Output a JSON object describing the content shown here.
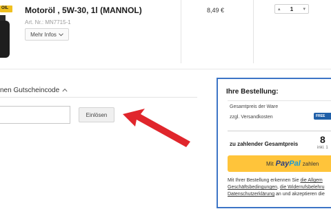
{
  "product": {
    "logo_text": "OIL",
    "title": "Motoröl , 5W-30, 1l (MANNOL)",
    "article_number": "Art. Nr.: MN7715-1",
    "more_info_label": "Mehr Infos",
    "price": "8,49 €",
    "quantity": "1"
  },
  "voucher": {
    "link_text": "nen Gutscheincode",
    "input_value": "",
    "redeem_label": "Einlösen"
  },
  "order": {
    "title": "Ihre Bestellung:",
    "goods_label": "Gesamtpreis der Ware",
    "shipping_label": "zzgl. Versandkosten",
    "shipping_badge": "FREE",
    "total_label": "zu zahlender Gesamtpreis",
    "total_value": "8",
    "incl_text": "inkl. 1",
    "paypal_prefix": "Mit",
    "paypal_brand_1": "Pay",
    "paypal_brand_2": "Pal",
    "paypal_suffix": "zahlen",
    "legal_1": "Mit Ihrer Bestellung erkennen Sie ",
    "legal_link_1": "die Allgem",
    "legal_link_2": "Geschäftsbedingungen",
    "legal_2": ", ",
    "legal_link_3": "die Widerrufsbelehru",
    "legal_link_4": "Datenschutzerklärung",
    "legal_3": " an und akzeptieren die"
  },
  "colors": {
    "accent_blue": "#3b74c6",
    "arrow_red": "#e0262c",
    "paypal_yellow": "#ffc43a"
  }
}
